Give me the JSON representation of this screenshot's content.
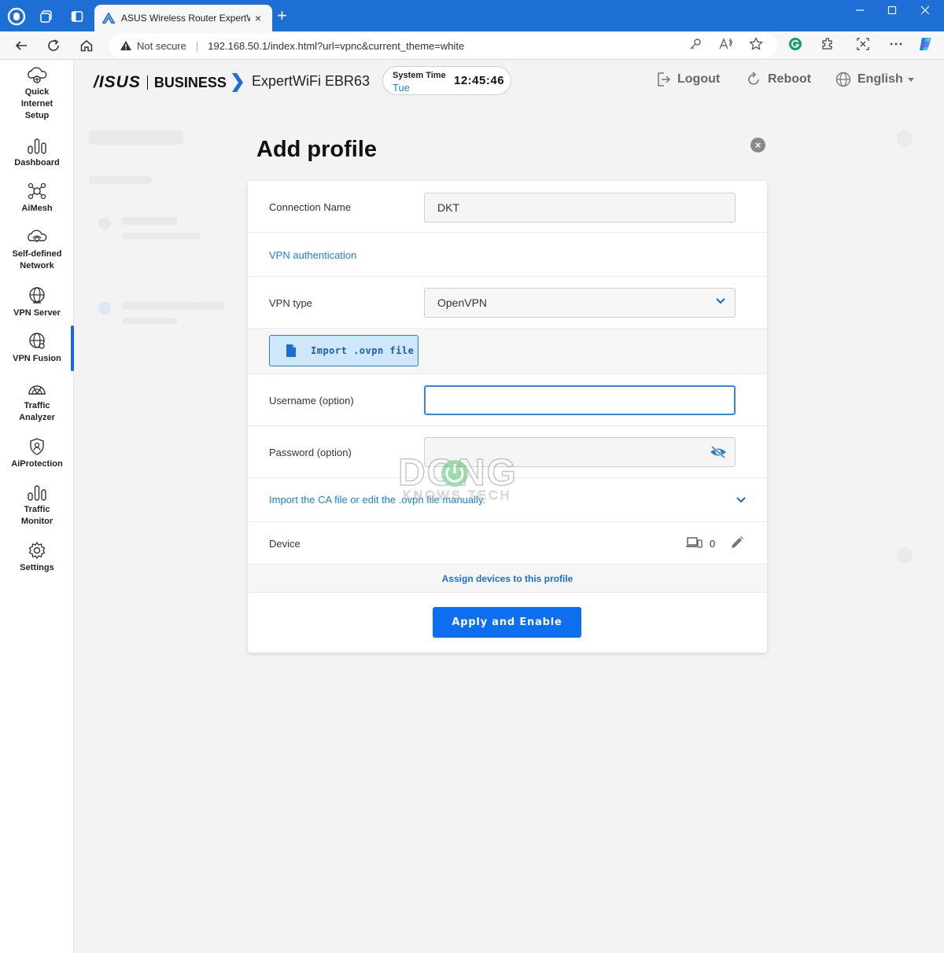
{
  "browser": {
    "tab_title": "ASUS Wireless Router ExpertWiFi",
    "tab_close": "×",
    "new_tab": "+",
    "security_label": "Not secure",
    "url": "192.168.50.1/index.html?url=vpnc&current_theme=white"
  },
  "sidebar": {
    "items": [
      {
        "label": "Quick\nInternet\nSetup"
      },
      {
        "label": "Dashboard"
      },
      {
        "label": "AiMesh"
      },
      {
        "label": "Self-defined\nNetwork"
      },
      {
        "label": "VPN Server"
      },
      {
        "label": "VPN Fusion"
      },
      {
        "label": "Traffic\nAnalyzer"
      },
      {
        "label": "AiProtection"
      },
      {
        "label": "Traffic\nMonitor"
      },
      {
        "label": "Settings"
      }
    ],
    "active_index": 5
  },
  "header": {
    "brand": "/ISUS",
    "brand_sub": "BUSINESS",
    "model": "ExpertWiFi EBR63",
    "system_time_label": "System Time",
    "system_day": "Tue",
    "system_time": "12:45:46",
    "logout": "Logout",
    "reboot": "Reboot",
    "language": "English"
  },
  "modal": {
    "title": "Add profile",
    "connection_name_label": "Connection Name",
    "connection_name_value": "DKT",
    "vpn_auth_link": "VPN authentication",
    "vpn_type_label": "VPN type",
    "vpn_type_value": "OpenVPN",
    "import_button": "Import .ovpn file",
    "username_label": "Username (option)",
    "username_value": "",
    "password_label": "Password (option)",
    "ca_link": "Import the CA file or edit the .ovpn file manually.",
    "device_label": "Device",
    "device_count": "0",
    "assign_link": "Assign devices to this profile",
    "apply_button": "Apply and Enable"
  },
  "watermark": {
    "big": "DONG",
    "small": "KNOWS TECH"
  },
  "colors": {
    "browser_blue": "#1d6fd6",
    "accent": "#0d6ef0",
    "link": "#1e7fd8"
  }
}
